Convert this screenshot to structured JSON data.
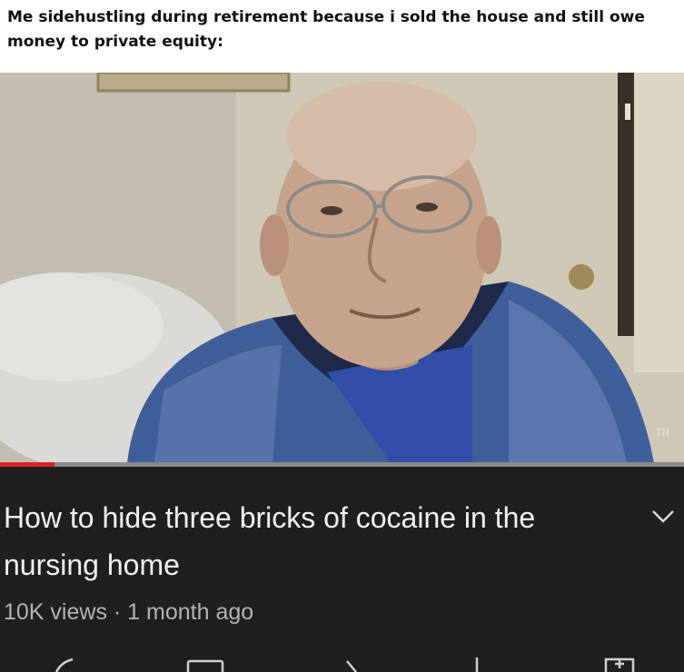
{
  "caption": "Me sidehustling during retirement because i sold the house and still owe money to private equity:",
  "video": {
    "progress_fraction": 0.08,
    "accent_color": "#d8262b"
  },
  "info": {
    "title": "How to hide three bricks of cocaine in the nursing home",
    "views": "10K views",
    "separator": " · ",
    "age": "1 month ago"
  },
  "icons": {
    "expand": "chevron-down-icon",
    "actions": [
      "like-icon",
      "add-to-queue-icon",
      "share-icon",
      "download-icon",
      "save-icon"
    ]
  }
}
